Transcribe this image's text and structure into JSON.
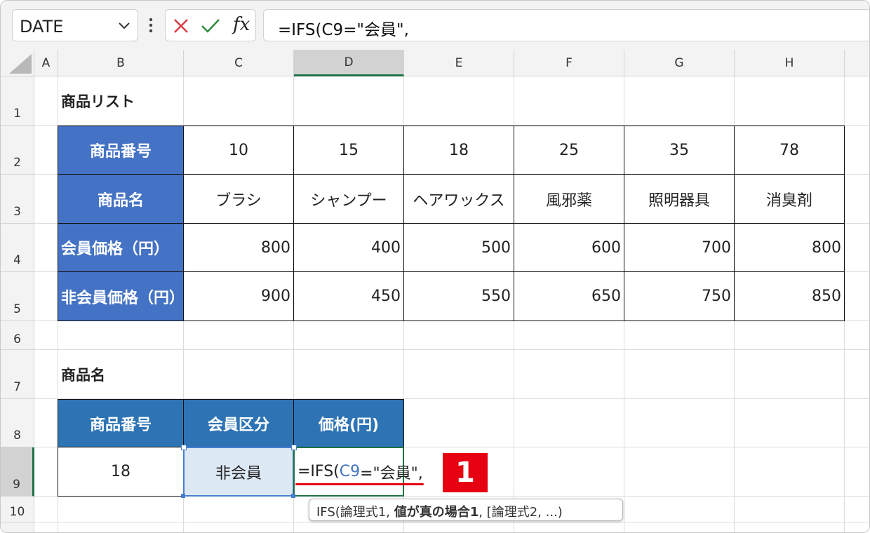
{
  "formula_bar": {
    "name_box": "DATE",
    "formula": "=IFS(C9=\"会員\","
  },
  "columns": [
    "A",
    "B",
    "C",
    "D",
    "E",
    "F",
    "G",
    "H"
  ],
  "rows": [
    "1",
    "2",
    "3",
    "4",
    "5",
    "6",
    "7",
    "8",
    "9",
    "10"
  ],
  "price_list": {
    "title": "商品リスト",
    "row_labels": [
      "商品番号",
      "商品名",
      "会員価格（円）",
      "非会員価格（円）"
    ],
    "product_numbers": [
      "10",
      "15",
      "18",
      "25",
      "35",
      "78"
    ],
    "product_names": [
      "ブラシ",
      "シャンプー",
      "ヘアワックス",
      "風邪薬",
      "照明器具",
      "消臭剤"
    ],
    "member_prices": [
      "800",
      "400",
      "500",
      "600",
      "700",
      "800"
    ],
    "nonmember_prices": [
      "900",
      "450",
      "550",
      "650",
      "750",
      "850"
    ]
  },
  "lookup": {
    "title": "商品名",
    "headers": [
      "商品番号",
      "会員区分",
      "価格(円)"
    ],
    "product_number": "18",
    "member_type": "非会員",
    "formula_part1": "=IFS(",
    "formula_ref": "C9",
    "formula_part2": "=\"会員\","
  },
  "tooltip": {
    "prefix": "IFS(論理式1, ",
    "bold": "値が真の場合1",
    "suffix": ", [論理式2, ...)"
  },
  "step_badge": "1",
  "colors": {
    "header_fill": "#4472c4",
    "lookup_header_fill": "#2e74b5",
    "selected_column_accent": "#1e7145",
    "reference_color": "#4472c4",
    "badge": "#e60012"
  }
}
